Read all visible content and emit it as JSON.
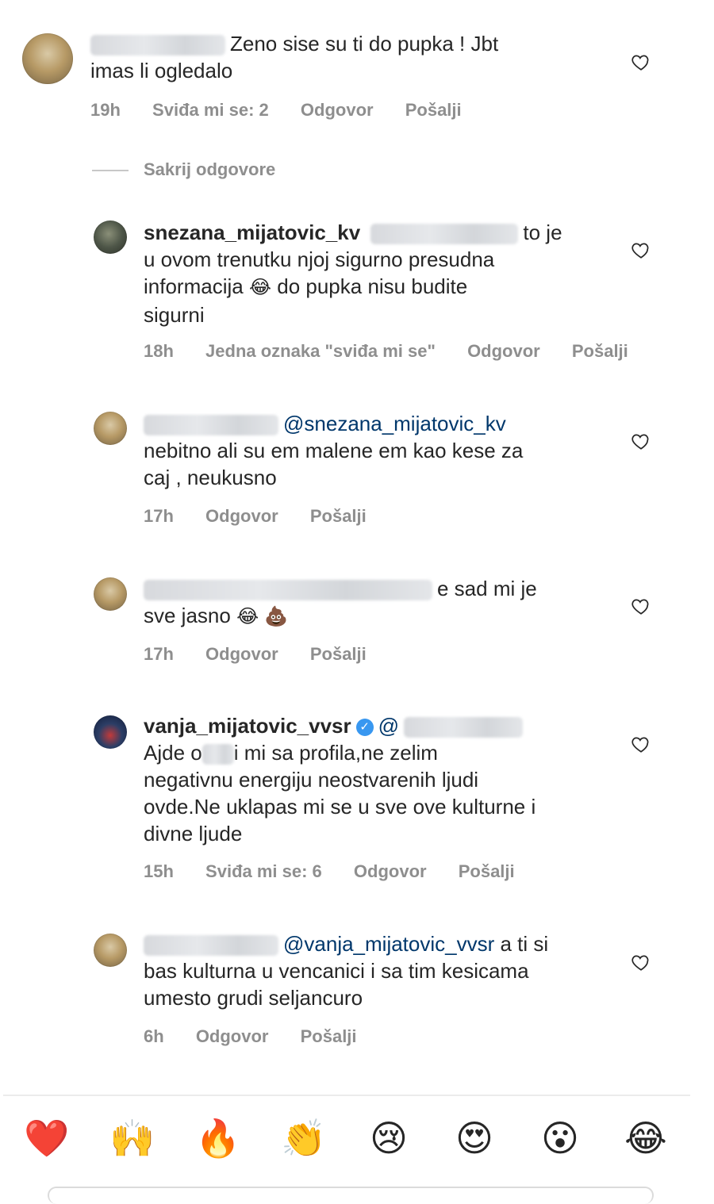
{
  "comments": [
    {
      "text": "Zeno sise su ti do pupka ! Jbt imas li ogledalo",
      "line1": "Zeno sise su ti do pupka ! Jbt",
      "line2": "imas li ogledalo",
      "time": "19h",
      "likes": "Sviđa mi se: 2",
      "reply": "Odgovor",
      "send": "Pošalji"
    },
    {
      "username": "snezana_mijatovic_kv",
      "line1_end": "to je",
      "line2": "u ovom trenutku njoj sigurno presudna",
      "line3_a": "informacija",
      "line3_b": "do pupka nisu budite",
      "line4": "sigurni",
      "time": "18h",
      "likes": "Jedna oznaka \"sviđa mi se\"",
      "reply": "Odgovor",
      "send": "Pošalji"
    },
    {
      "mention": "@snezana_mijatovic_kv",
      "line2": "nebitno ali su em malene em kao kese za",
      "line3": "caj , neukusno",
      "time": "17h",
      "reply": "Odgovor",
      "send": "Pošalji"
    },
    {
      "line1_end": "e sad mi je",
      "line2": "sve jasno",
      "time": "17h",
      "reply": "Odgovor",
      "send": "Pošalji"
    },
    {
      "username": "vanja_mijatovic_vvsr",
      "mention_prefix": "@",
      "line2_a": "Ajde o",
      "line2_b": "i mi sa profila,ne zelim",
      "line3": "negativnu energiju neostvarenih ljudi",
      "line4": "ovde.Ne uklapas mi se u sve ove kulturne i",
      "line5": "divne ljude",
      "time": "15h",
      "likes": "Sviđa mi se: 6",
      "reply": "Odgovor",
      "send": "Pošalji"
    },
    {
      "mention": "@vanja_mijatovic_vvsr",
      "line1_end": "a ti si",
      "line2": "bas kulturna u vencanici i sa tim kesicama",
      "line3": "umesto grudi seljancuro",
      "time": "6h",
      "reply": "Odgovor",
      "send": "Pošalji"
    }
  ],
  "hide_replies": "Sakrij odgovore",
  "emoji": {
    "laugh": "😂",
    "poop": "💩",
    "heart_react": "❤️",
    "raised_hands": "🙌",
    "fire": "🔥",
    "clap": "👏",
    "cry": "😢",
    "heart_eyes": "😍",
    "wow": "😮",
    "laugh_react": "😂"
  },
  "colors": {
    "mention": "#00376b",
    "meta": "#8e8e8e",
    "verified": "#3897f0"
  }
}
